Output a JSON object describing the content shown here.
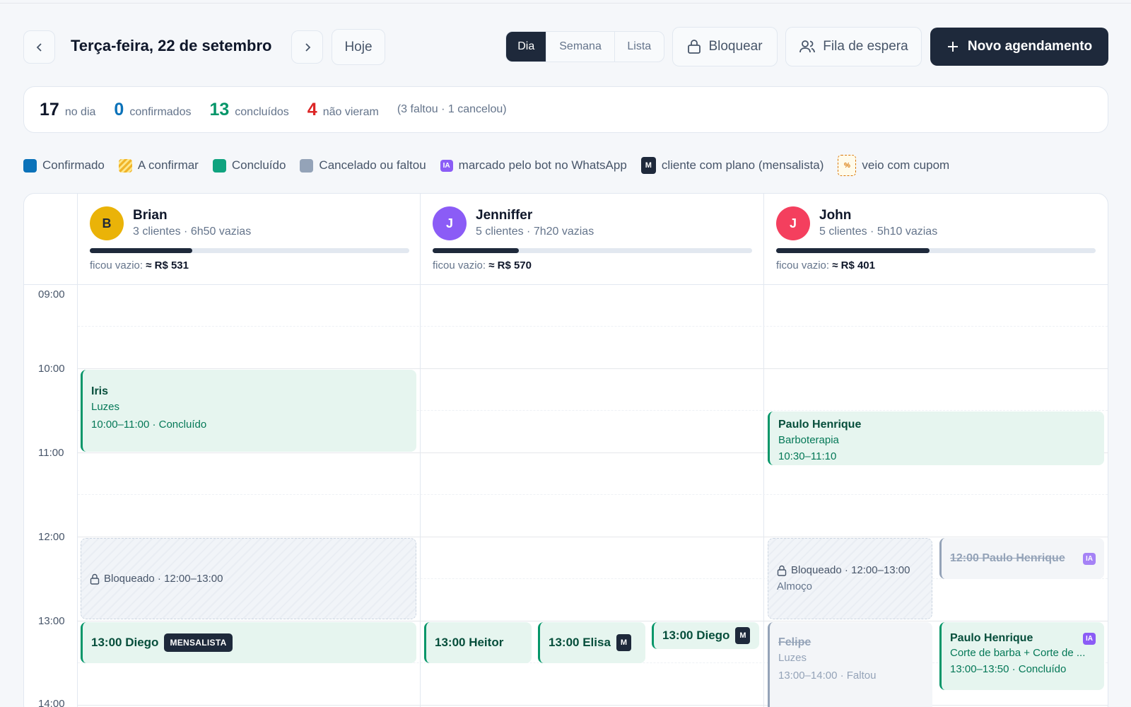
{
  "header": {
    "date_title": "Terça-feira, 22 de setembro",
    "today_label": "Hoje",
    "views": [
      "Dia",
      "Semana",
      "Lista"
    ],
    "active_view": "Dia",
    "block_label": "Bloquear",
    "waitlist_label": "Fila de espera",
    "new_label": "Novo agendamento"
  },
  "summary": {
    "day_count": "17",
    "day_label": "no dia",
    "confirmed_count": "0",
    "confirmed_label": "confirmados",
    "done_count": "13",
    "done_label": "concluídos",
    "noshow_count": "4",
    "noshow_label": "não vieram",
    "note": "(3 faltou · 1 cancelou)"
  },
  "colors": {
    "confirmed": "#0b72b9",
    "pending": "#f0b429",
    "done": "#10a37f",
    "cancelled": "#94a3b8",
    "ia": "#8b5cf6",
    "plan": "#1e293b",
    "coupon": "#d97706",
    "stat_confirmed": "#0b72b9",
    "stat_done": "#059669",
    "stat_noshow": "#dc2626"
  },
  "legend": {
    "confirmed": "Confirmado",
    "pending": "A confirmar",
    "done": "Concluído",
    "cancelled": "Cancelado ou faltou",
    "ia_chip": "IA",
    "ia": "marcado pelo bot no WhatsApp",
    "plan_chip": "M",
    "plan": "cliente com plano (mensalista)",
    "coupon_chip": "%",
    "coupon": "veio com cupom"
  },
  "times": [
    "09:00",
    "10:00",
    "11:00",
    "12:00",
    "13:00",
    "14:00"
  ],
  "barbers": [
    {
      "initial": "B",
      "name": "Brian",
      "sub": "3 clientes · 6h50 vazias",
      "idle_label": "ficou vazio:",
      "idle_value": "≈ R$ 531",
      "occupancy": 0.32,
      "avatar_color": "#eab308",
      "avatar_text": "#1f2937"
    },
    {
      "initial": "J",
      "name": "Jenniffer",
      "sub": "5 clientes · 7h20 vazias",
      "idle_label": "ficou vazio:",
      "idle_value": "≈ R$ 570",
      "occupancy": 0.27,
      "avatar_color": "#8b5cf6",
      "avatar_text": "#ffffff"
    },
    {
      "initial": "J",
      "name": "John",
      "sub": "5 clientes · 5h10 vazias",
      "idle_label": "ficou vazio:",
      "idle_value": "≈ R$ 401",
      "occupancy": 0.48,
      "avatar_color": "#f43f5e",
      "avatar_text": "#ffffff"
    }
  ],
  "events": {
    "iris": {
      "name": "Iris",
      "service": "Luzes",
      "time": "10:00–11:00 · Concluído"
    },
    "brian_block": {
      "label": "Bloqueado · 12:00–13:00"
    },
    "brian_diego": {
      "label": "13:00 Diego",
      "tag": "MENSALISTA"
    },
    "heitor": {
      "label": "13:00 Heitor"
    },
    "elisa": {
      "label": "13:00 Elisa",
      "chip": "M"
    },
    "jen_diego": {
      "label": "13:00 Diego",
      "chip": "M"
    },
    "paulo1": {
      "name": "Paulo Henrique",
      "service": "Barboterapia",
      "time": "10:30–11:10"
    },
    "john_block": {
      "label": "Bloqueado · 12:00–13:00",
      "note": "Almoço"
    },
    "paulo_cancel": {
      "label": "12:00 Paulo Henrique",
      "chip": "IA"
    },
    "felipe": {
      "name": "Felipe",
      "service": "Luzes",
      "time": "13:00–14:00 · Faltou"
    },
    "paulo2": {
      "name": "Paulo Henrique",
      "chip": "IA",
      "service": "Corte de barba + Corte de ...",
      "time": "13:00–13:50 · Concluído"
    }
  }
}
